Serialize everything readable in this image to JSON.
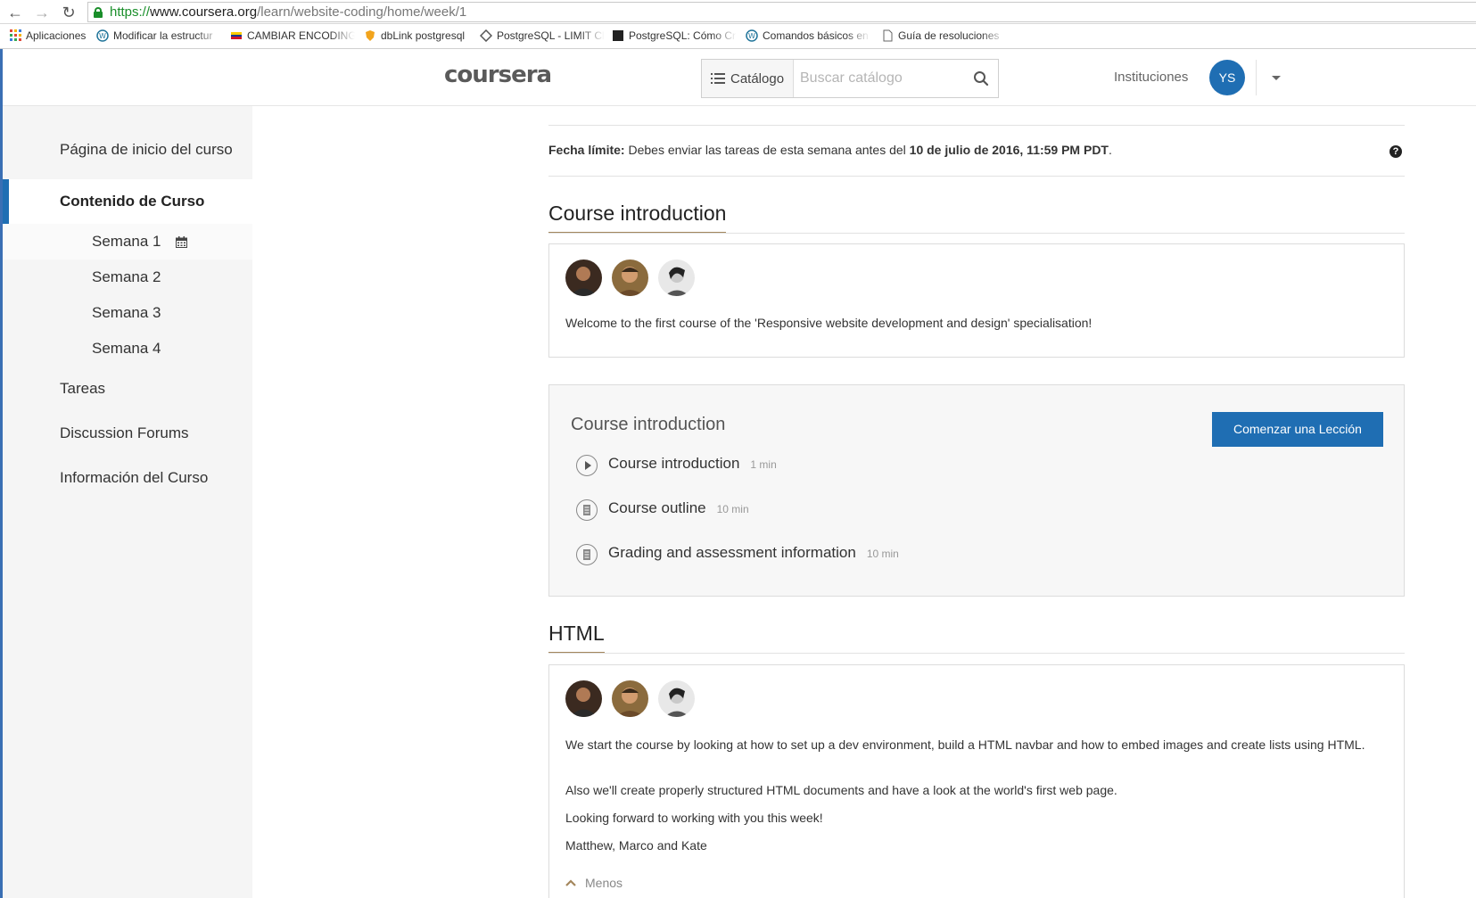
{
  "browser": {
    "url_scheme": "https://",
    "url_host": "www.coursera.org",
    "url_path": "/learn/website-coding/home/week/1",
    "bookmarks": [
      {
        "label": "Aplicaciones",
        "icon": "apps-grid-icon"
      },
      {
        "label": "Modificar la estructur",
        "icon": "wordpress-icon"
      },
      {
        "label": "CAMBIAR ENCODING",
        "icon": "flag-icon"
      },
      {
        "label": "dbLink postgresql",
        "icon": "shield-icon"
      },
      {
        "label": "PostgreSQL - LIMIT Cl",
        "icon": "diamond-icon"
      },
      {
        "label": "PostgreSQL: Cómo Cr",
        "icon": "square-icon"
      },
      {
        "label": "Comandos básicos en",
        "icon": "wordpress-icon"
      },
      {
        "label": "Guía de resoluciones",
        "icon": "page-icon"
      }
    ]
  },
  "header": {
    "logo": "coursera",
    "catalog_label": "Catálogo",
    "search_placeholder": "Buscar catálogo",
    "institutions": "Instituciones",
    "avatar_initials": "YS",
    "colors": {
      "brand": "#1f6eb3"
    }
  },
  "sidebar": {
    "items": [
      {
        "label": "Página de inicio del curso"
      },
      {
        "label": "Contenido de Curso"
      },
      {
        "label": "Semana 1"
      },
      {
        "label": "Semana 2"
      },
      {
        "label": "Semana 3"
      },
      {
        "label": "Semana 4"
      },
      {
        "label": "Tareas"
      },
      {
        "label": "Discussion Forums"
      },
      {
        "label": "Información del Curso"
      }
    ]
  },
  "main": {
    "deadline": {
      "label": "Fecha límite:",
      "text": " Debes enviar las tareas de esta semana antes del ",
      "date": "10 de julio de 2016, 11:59 PM PDT",
      "end": "."
    },
    "section1": {
      "title": "Course introduction",
      "description": "Welcome to the first course of the 'Responsive website development and design' specialisation!"
    },
    "lesson": {
      "title": "Course introduction",
      "button": "Comenzar una Lección",
      "items": [
        {
          "name": "Course introduction",
          "time": "1 min",
          "icon": "play-icon"
        },
        {
          "name": "Course outline",
          "time": "10 min",
          "icon": "reading-icon"
        },
        {
          "name": "Grading and assessment information",
          "time": "10 min",
          "icon": "reading-icon"
        }
      ]
    },
    "section2": {
      "title": "HTML",
      "paragraphs": [
        "We start the course by looking at how to set up a dev environment, build a HTML navbar and how to embed images and create lists using HTML.",
        "Also we'll create properly structured HTML documents and have a look at the world's first web page.",
        "Looking forward to working with you this week!",
        "Matthew, Marco and Kate"
      ],
      "less_label": "Menos"
    }
  }
}
